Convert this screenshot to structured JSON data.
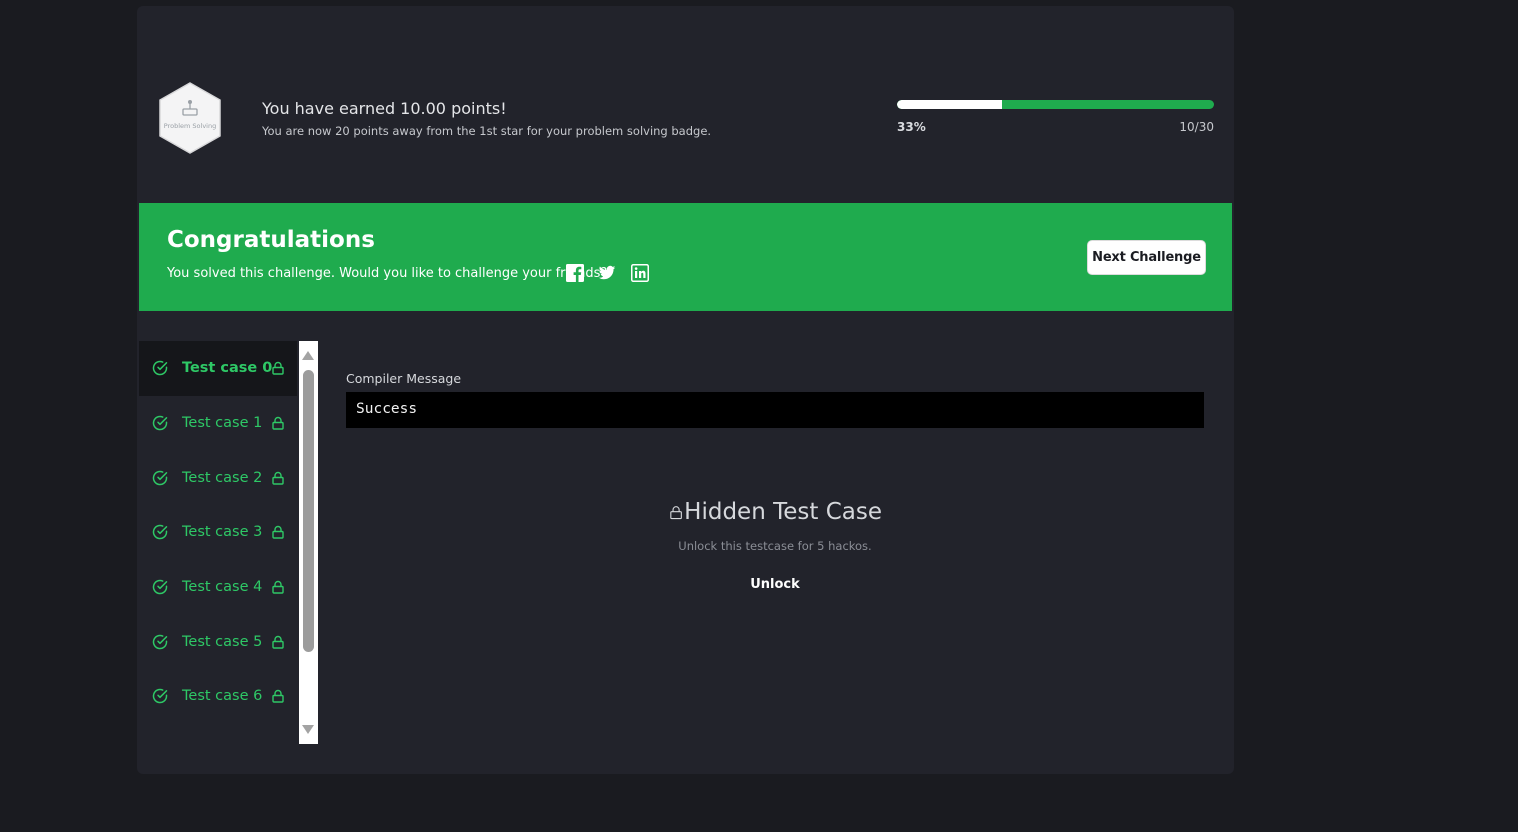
{
  "header": {
    "badge_label": "Problem Solving",
    "points_title": "You have earned 10.00 points!",
    "points_subtitle": "You are now 20 points away from the 1st star for your problem solving badge.",
    "progress": {
      "fraction": 0.33,
      "percent_label": "33%",
      "count_label": "10/30",
      "fill_color": "#ffffff",
      "track_color": "#1fab4e"
    }
  },
  "banner": {
    "title": "Congratulations",
    "subtitle": "You solved this challenge. Would you like to challenge your friends?",
    "social_icons": [
      "facebook-icon",
      "twitter-icon",
      "linkedin-icon"
    ],
    "next_button": "Next Challenge",
    "background_color": "#1fab4e"
  },
  "test_cases": {
    "items": [
      {
        "label": "Test case 0",
        "active": true
      },
      {
        "label": "Test case 1",
        "active": false
      },
      {
        "label": "Test case 2",
        "active": false
      },
      {
        "label": "Test case 3",
        "active": false
      },
      {
        "label": "Test case 4",
        "active": false
      },
      {
        "label": "Test case 5",
        "active": false
      },
      {
        "label": "Test case 6",
        "active": false
      }
    ],
    "status_color": "#2ec866"
  },
  "output": {
    "compiler_label": "Compiler Message",
    "compiler_message": "Success",
    "hidden_title": "Hidden Test Case",
    "hidden_subtitle": "Unlock this testcase for 5 hackos.",
    "unlock_label": "Unlock"
  }
}
